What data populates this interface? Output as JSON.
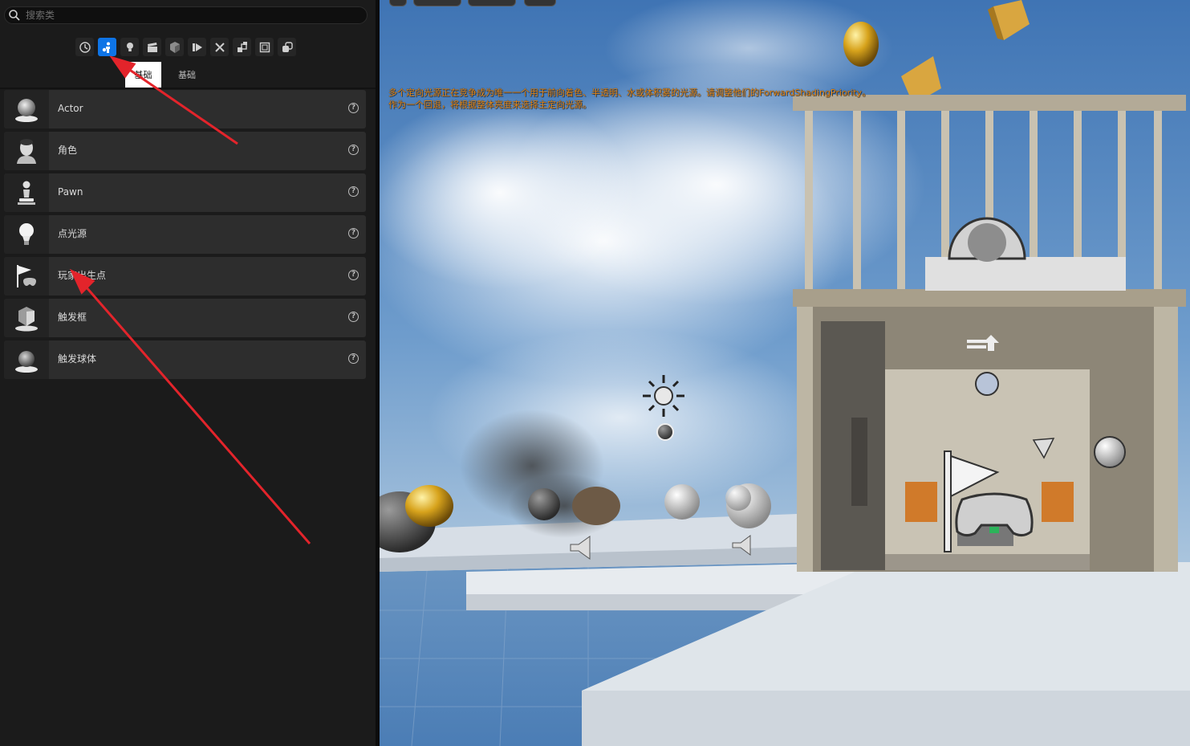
{
  "search": {
    "placeholder": "搜索类"
  },
  "category_tabs": [
    {
      "icon": "recent-clock-icon",
      "active": false
    },
    {
      "icon": "basic-actor-icon",
      "active": true
    },
    {
      "icon": "light-bulb-icon",
      "active": false
    },
    {
      "icon": "cinematic-clapper-icon",
      "active": false
    },
    {
      "icon": "visual-effects-cube-icon",
      "active": false
    },
    {
      "icon": "geometry-icon",
      "active": false
    },
    {
      "icon": "volumes-icon",
      "active": false
    },
    {
      "icon": "all-classes-icon",
      "active": false
    },
    {
      "icon": "shapes-icon",
      "active": false
    },
    {
      "icon": "placeable-icon",
      "active": false
    }
  ],
  "subtabs": [
    "基础",
    "基础"
  ],
  "items": [
    {
      "label": "Actor",
      "icon": "actor-sphere-icon"
    },
    {
      "label": "角色",
      "icon": "character-head-icon"
    },
    {
      "label": "Pawn",
      "icon": "pawn-icon"
    },
    {
      "label": "点光源",
      "icon": "point-light-icon"
    },
    {
      "label": "玩家出生点",
      "icon": "player-start-flag-icon"
    },
    {
      "label": "触发框",
      "icon": "trigger-box-icon"
    },
    {
      "label": "触发球体",
      "icon": "trigger-sphere-icon"
    }
  ],
  "viewport": {
    "warning_line1": "多个定向光源正在竞争成为唯一一个用于前向着色、半透明、水或体积雾的光源。请调整他们的ForwardShadingPriority。",
    "warning_line2": "作为一个回退，将根据整体亮度来选择主定向光源。",
    "warning_color": "#e58a1d"
  },
  "annotation": {
    "arrow_color": "#e3242b"
  },
  "colors": {
    "accent": "#0e74e6",
    "panel_bg": "#1b1b1b",
    "item_bg": "#2d2d2d"
  }
}
